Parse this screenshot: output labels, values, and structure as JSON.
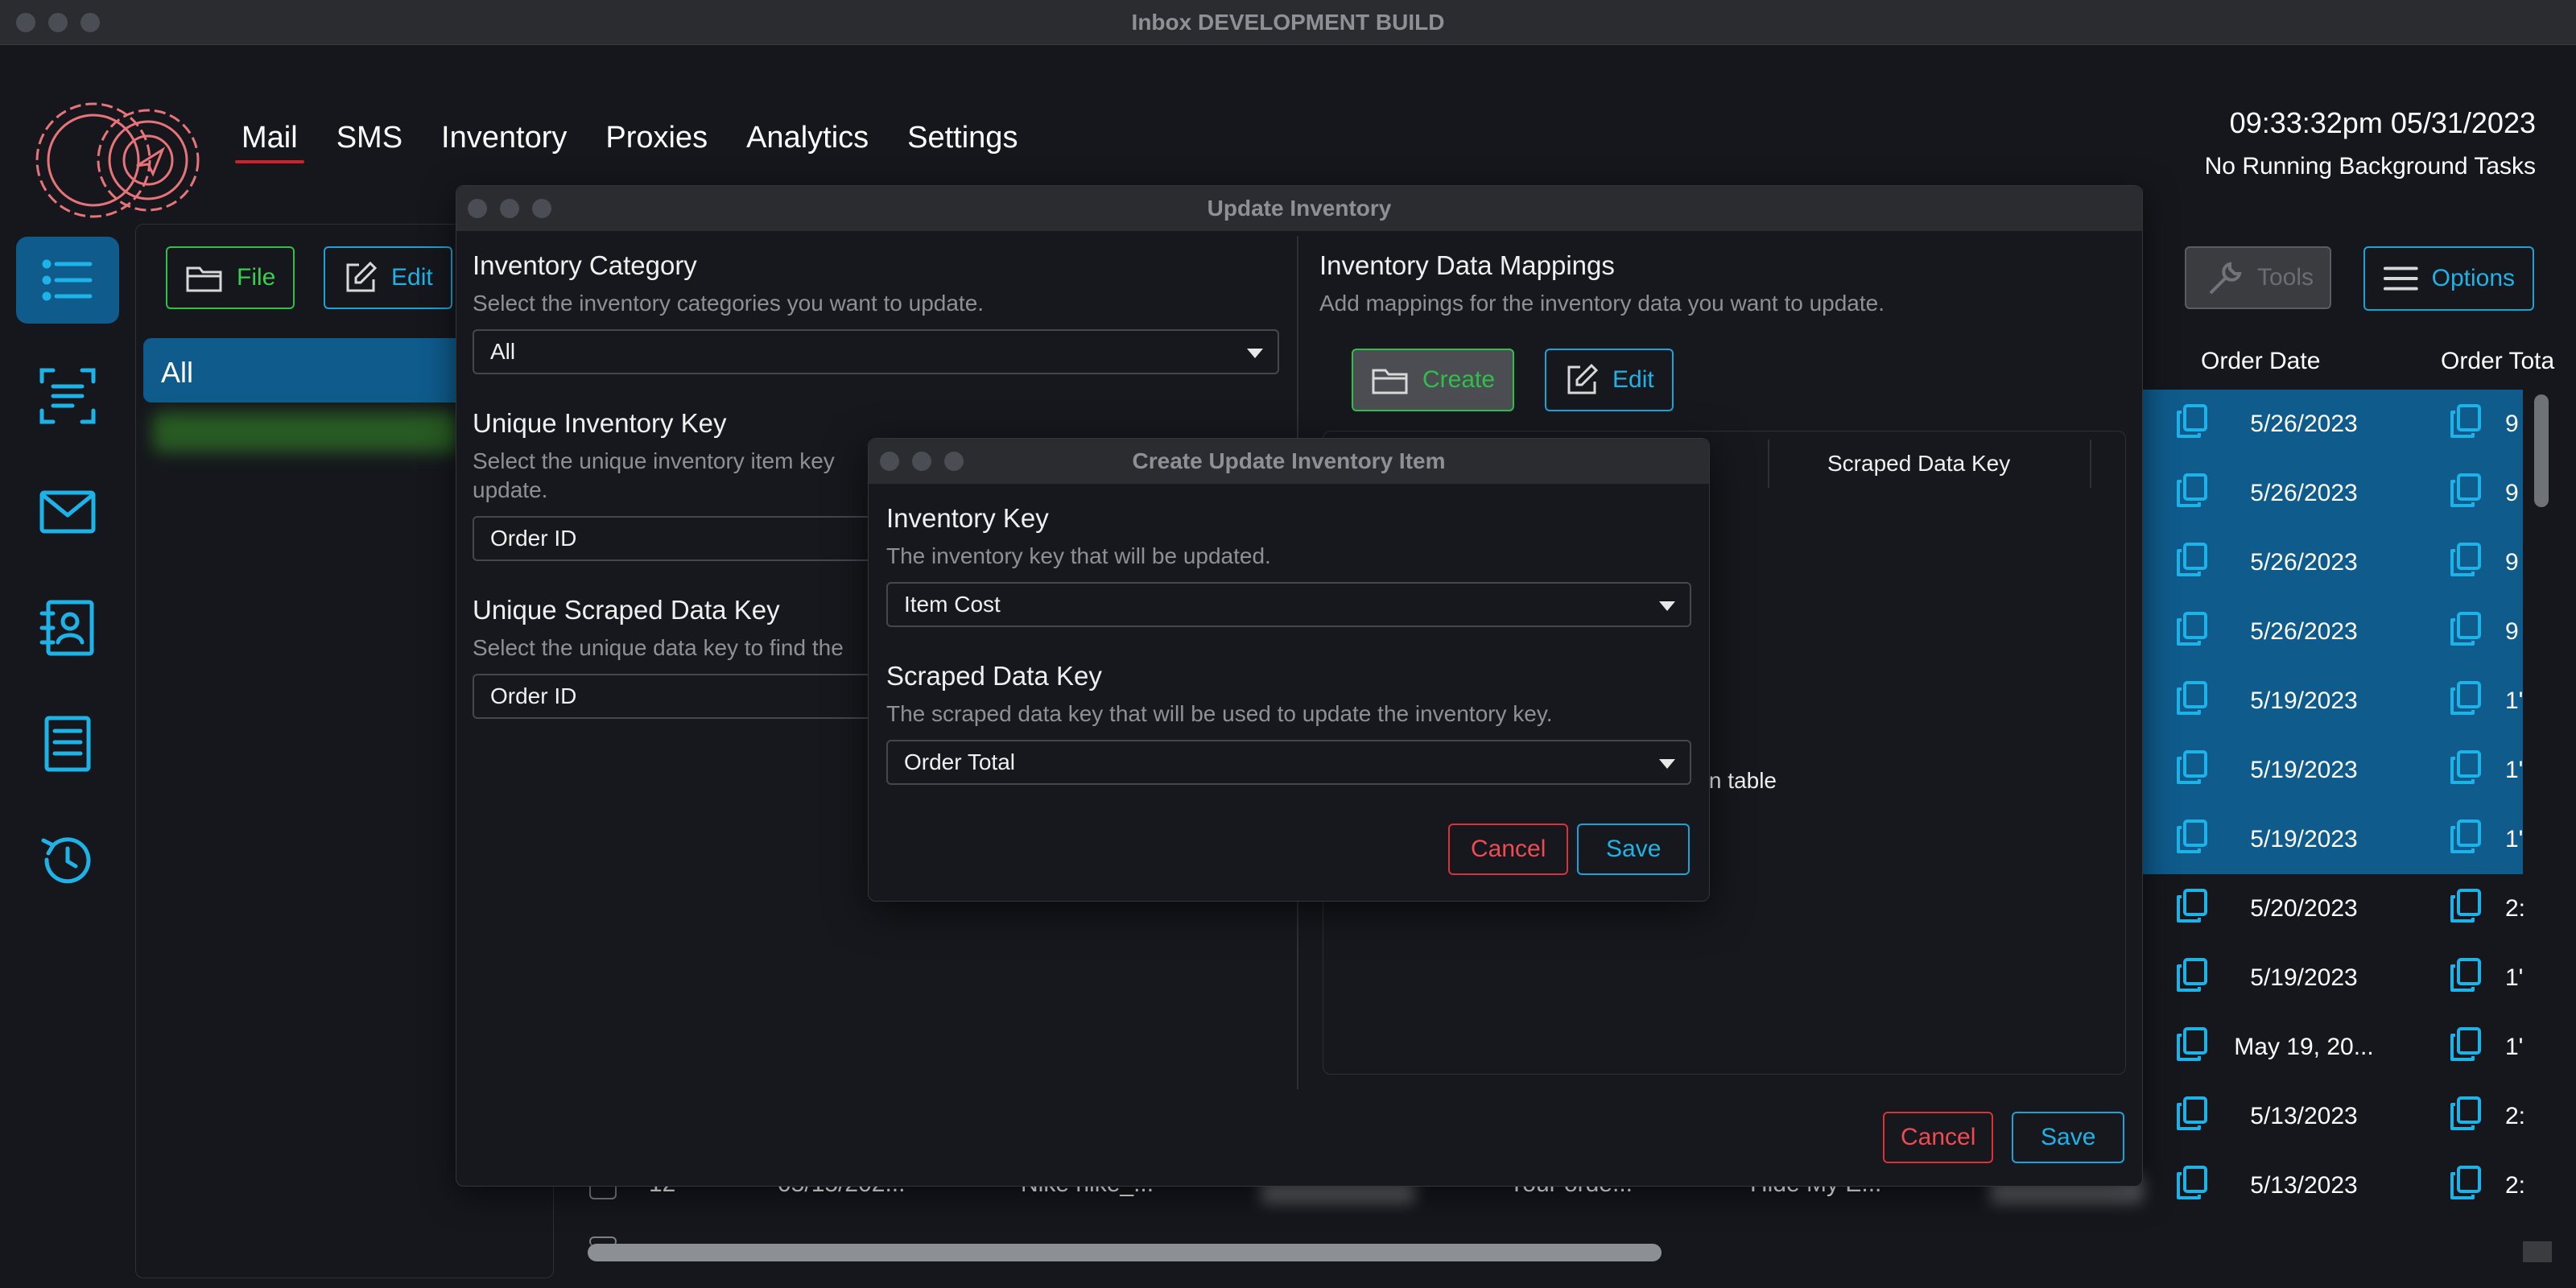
{
  "window": {
    "title": "Inbox DEVELOPMENT BUILD"
  },
  "nav": {
    "items": [
      {
        "label": "Mail",
        "active": true
      },
      {
        "label": "SMS"
      },
      {
        "label": "Inventory"
      },
      {
        "label": "Proxies"
      },
      {
        "label": "Analytics"
      },
      {
        "label": "Settings"
      }
    ]
  },
  "header": {
    "clock": "09:33:32pm 05/31/2023",
    "status": "No Running Background Tasks"
  },
  "sidebar": {
    "icons": [
      "list-icon",
      "scan-text-icon",
      "mail-icon",
      "contacts-icon",
      "document-icon",
      "history-icon"
    ]
  },
  "left_panel": {
    "file_label": "File",
    "edit_label": "Edit",
    "all_label": "All"
  },
  "toolbar_right": {
    "tools_label": "Tools",
    "options_label": "Options"
  },
  "table": {
    "col_order_date": "Order Date",
    "col_order_total": "Order Tota",
    "rows": [
      {
        "date": "5/26/2023",
        "total": "9",
        "selected": true
      },
      {
        "date": "5/26/2023",
        "total": "9",
        "selected": true
      },
      {
        "date": "5/26/2023",
        "total": "9",
        "selected": true
      },
      {
        "date": "5/26/2023",
        "total": "9",
        "selected": true
      },
      {
        "date": "5/19/2023",
        "total": "1'",
        "selected": true
      },
      {
        "date": "5/19/2023",
        "total": "1'",
        "selected": true
      },
      {
        "date": "5/19/2023",
        "total": "1'",
        "selected": true
      },
      {
        "date": "5/20/2023",
        "total": "2:",
        "selected": false
      },
      {
        "date": "5/19/2023",
        "total": "1'",
        "selected": false
      },
      {
        "date": "May 19, 20...",
        "total": "1'",
        "selected": false
      },
      {
        "date": "5/13/2023",
        "total": "2:",
        "selected": false
      },
      {
        "date": "5/13/2023",
        "total": "2:",
        "selected": false
      }
    ],
    "bottom_row": {
      "index": "12",
      "date": "05/15/202...",
      "product": "Nike nike_...",
      "subject": "Your orde...",
      "email": "Hide My E..."
    }
  },
  "update_dialog": {
    "title": "Update Inventory",
    "category_title": "Inventory Category",
    "category_desc": "Select the inventory categories you want to update.",
    "category_value": "All",
    "unique_key_title": "Unique Inventory Key",
    "unique_key_desc_1": "Select the unique inventory item key",
    "unique_key_desc_2": "update.",
    "unique_key_value": "Order ID",
    "unique_scraped_title": "Unique Scraped Data Key",
    "unique_scraped_desc": "Select the unique data key to find the",
    "unique_scraped_value": "Order ID",
    "mappings_title": "Inventory Data Mappings",
    "mappings_desc": "Add mappings for the inventory data you want to update.",
    "create_label": "Create",
    "edit_label": "Edit",
    "col_scraped": "Scraped Data Key",
    "empty_fragment": "ent in table",
    "cancel_label": "Cancel",
    "save_label": "Save"
  },
  "create_dialog": {
    "title": "Create Update Inventory Item",
    "inv_key_title": "Inventory Key",
    "inv_key_desc": "The inventory key that will be updated.",
    "inv_key_value": "Item Cost",
    "scraped_title": "Scraped Data Key",
    "scraped_desc": "The scraped data key that will be used to update the inventory key.",
    "scraped_value": "Order Total",
    "cancel_label": "Cancel",
    "save_label": "Save"
  },
  "colors": {
    "accent_blue": "#1eb3e8",
    "selected_row": "#0e5b8c",
    "green": "#36d04f",
    "red": "#ef4b52",
    "nav_underline": "#d51f27"
  }
}
